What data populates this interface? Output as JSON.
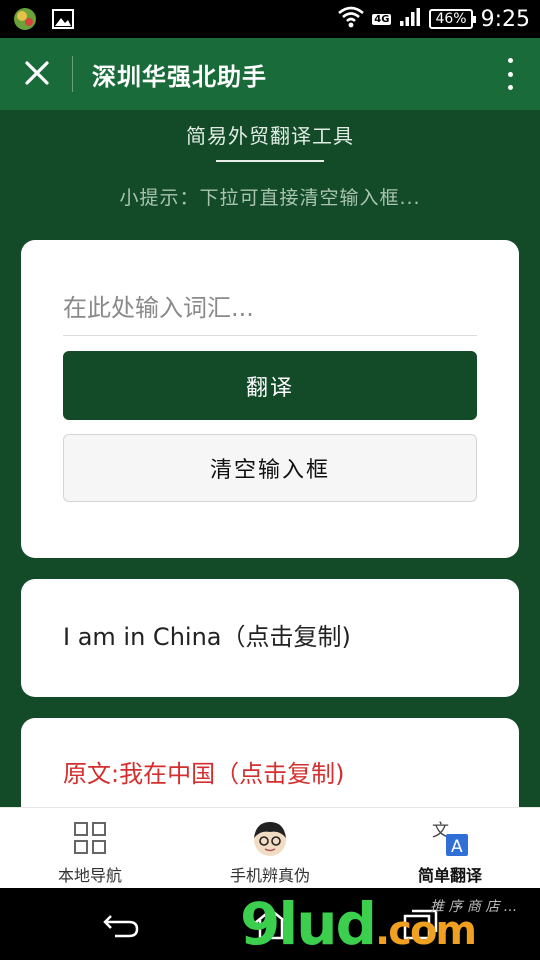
{
  "status_bar": {
    "time": "9:25",
    "battery": "46%",
    "network": "4G"
  },
  "header": {
    "title": "深圳华强北助手"
  },
  "main": {
    "heading": "简易外贸翻译工具",
    "tip": "小提示：下拉可直接清空输入框...",
    "input_placeholder": "在此处输入词汇...",
    "input_value": "",
    "translate_label": "翻译",
    "clear_label": "清空输入框",
    "result_text": "I am in China（点击复制)",
    "original_text": "原文:我在中国（点击复制)"
  },
  "bottom_nav": {
    "items": [
      {
        "label": "本地导航",
        "icon": "grid-icon"
      },
      {
        "label": "手机辨真伪",
        "icon": "face-avatar-icon"
      },
      {
        "label": "简单翻译",
        "icon": "translate-icon"
      }
    ]
  },
  "watermark": {
    "brand": "9lud",
    "tld": ".com",
    "small": "推 序 商 店 ..."
  },
  "colors": {
    "header_green": "#1a6b3a",
    "content_green": "#134a28",
    "accent_red": "#d32f2f"
  }
}
